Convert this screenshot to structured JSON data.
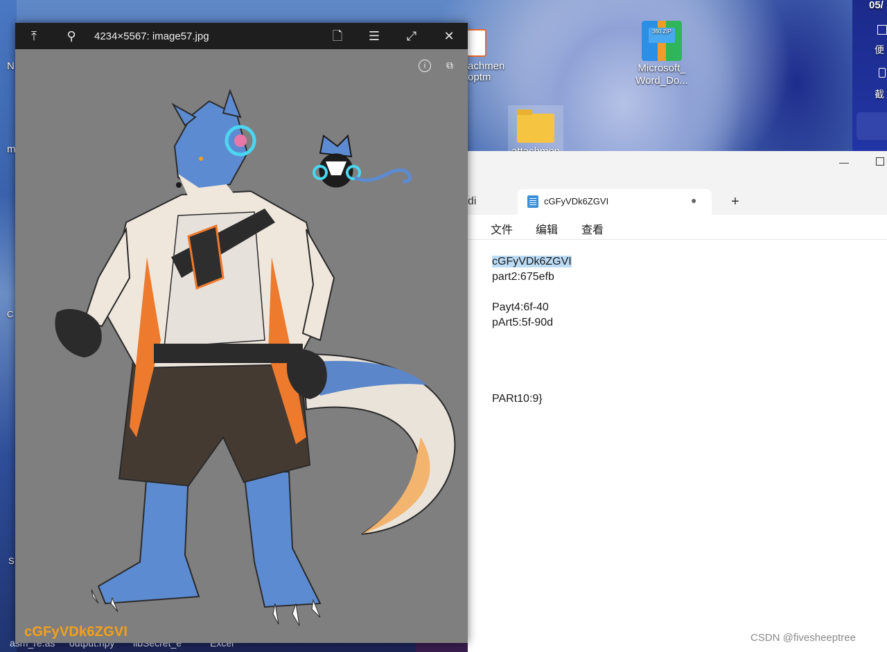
{
  "desktop": {
    "icons": [
      {
        "label_line1": "Microsoft_",
        "label_line2": "Word_Do..."
      },
      {
        "label_line1": "attachmen",
        "label_line2": ""
      },
      {
        "label_line1": "achmen",
        "label_line2": "optm"
      }
    ],
    "zip_tag": "360\nZIP",
    "left_fragments": [
      "N",
      "m",
      "C",
      "S"
    ],
    "right_fragments": [
      "05/",
      "便",
      "截"
    ],
    "taskbar_labels": [
      "asm_re.as",
      "output.npy",
      "libSecret_e",
      "Excel"
    ]
  },
  "viewer": {
    "title": "4234×5567: image57.jpg",
    "buttons": {
      "pin_top": "⤒",
      "pin": "⚲",
      "save": "🗋",
      "list": "☰",
      "fullscreen": "⤢",
      "close": "✕"
    },
    "info_glyph": "i",
    "rotate_glyph": "⧉",
    "watermark": "cGFyVDk6ZGVI"
  },
  "notepad": {
    "left_fragment": "di",
    "tab_title": "cGFyVDk6ZGVI",
    "tab_dot": "●",
    "new_tab": "+",
    "window_min": "—",
    "menu": {
      "file": "文件",
      "edit": "编辑",
      "view": "查看"
    },
    "lines": [
      "cGFyVDk6ZGVI",
      "part2:675efb",
      "",
      "Payt4:6f-40",
      "pArt5:5f-90d",
      "",
      "",
      "",
      "",
      "PARt10:9}"
    ]
  },
  "footer": {
    "watermark": "CSDN @fivesheeptree"
  },
  "colors": {
    "viewer_bg": "#7f7f7f",
    "selection": "#bcdcf5",
    "watermark": "#f4a01a"
  }
}
